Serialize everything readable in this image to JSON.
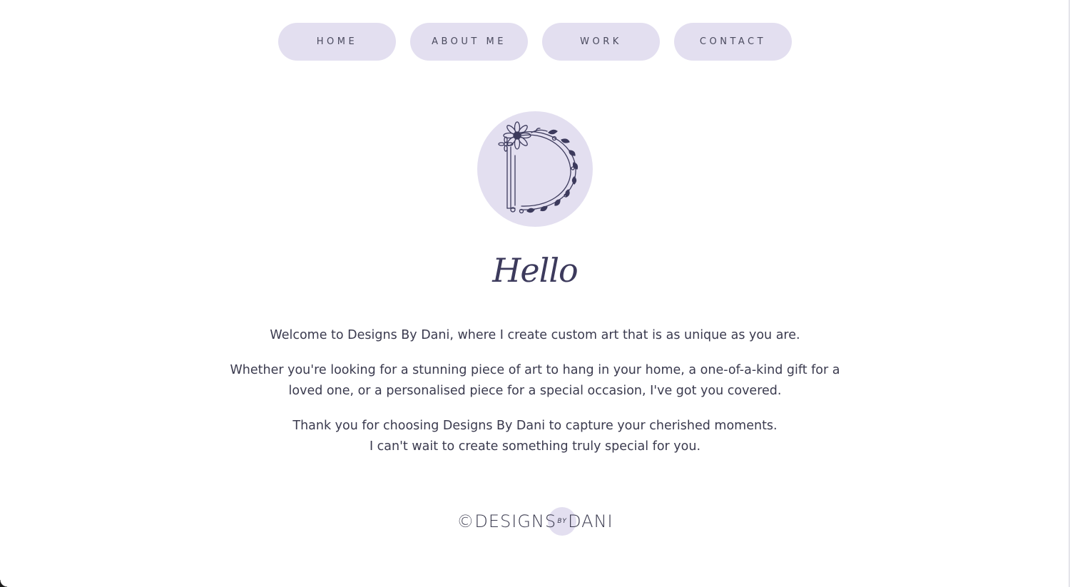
{
  "nav": {
    "items": [
      {
        "label": "HOME"
      },
      {
        "label": "ABOUT ME"
      },
      {
        "label": "WORK"
      },
      {
        "label": "CONTACT"
      }
    ]
  },
  "hero": {
    "logo_icon": "floral-letter-d-icon",
    "heading": "Hello"
  },
  "intro": {
    "paragraph_1": "Welcome to Designs By Dani, where I create custom art that is as unique as you are.",
    "paragraph_2_line_1": "Whether you're looking for a stunning piece of art to hang in your home, a one-of-a-kind gift for a",
    "paragraph_2_line_2": "loved one, or a personalised piece for a special occasion, I've got you covered.",
    "paragraph_3_line_1": "Thank you for choosing Designs By Dani to capture your cherished moments.",
    "paragraph_3_line_2": "I can't wait to create something truly special for you."
  },
  "footer": {
    "brand_left": "©DESIGNS",
    "brand_by": "BY",
    "brand_right": "DANI"
  },
  "colors": {
    "accent": "#e3dff0",
    "text": "#3a3a4e",
    "heading": "#3c3a5c"
  }
}
